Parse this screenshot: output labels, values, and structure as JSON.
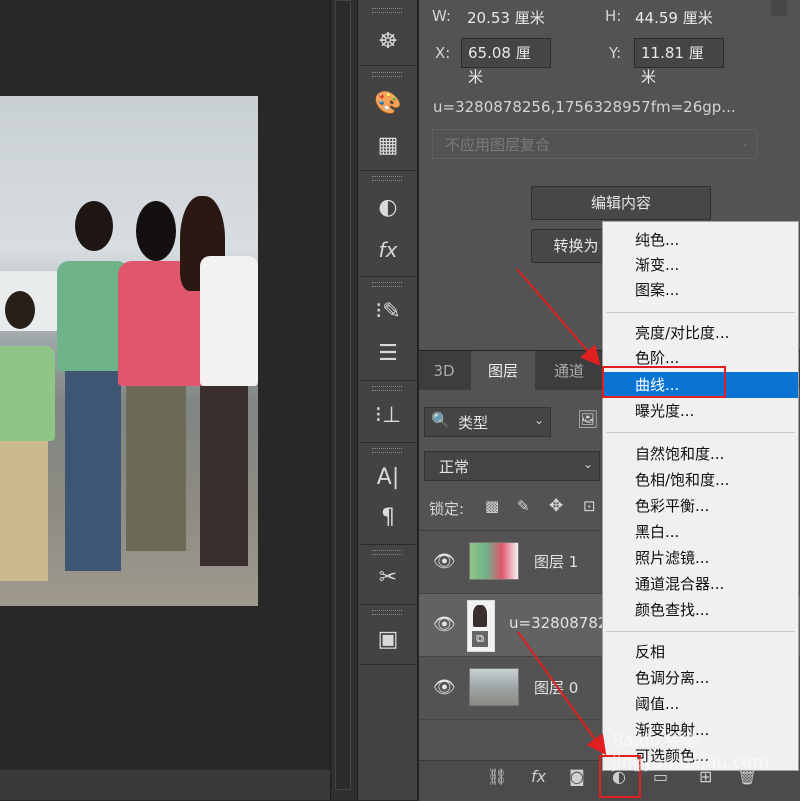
{
  "properties": {
    "w_label": "W:",
    "w_value": "20.53 厘米",
    "h_label": "H:",
    "h_value": "44.59 厘米",
    "x_label": "X:",
    "x_value": "65.08 厘米",
    "y_label": "Y:",
    "y_value": "11.81 厘米",
    "filename": "u=3280878256,1756328957fm=26gp...",
    "comp_select": "不应用图层复合",
    "edit_contents": "编辑内容",
    "convert_to": "转换为"
  },
  "tabs": [
    "3D",
    "图层",
    "通道"
  ],
  "layers_panel": {
    "filter_type": "类型",
    "blend_mode": "正常",
    "lock_label": "锁定:"
  },
  "layers": [
    {
      "name": "图层 1"
    },
    {
      "name": "u=32808782"
    },
    {
      "name": "图层 0"
    }
  ],
  "menu": {
    "group1": [
      "纯色...",
      "渐变...",
      "图案..."
    ],
    "group2": [
      "亮度/对比度...",
      "色阶...",
      "曲线...",
      "曝光度..."
    ],
    "group3": [
      "自然饱和度...",
      "色相/饱和度...",
      "色彩平衡...",
      "黑白...",
      "照片滤镜...",
      "通道混合器...",
      "颜色查找..."
    ],
    "group4": [
      "反相",
      "色调分离...",
      "阈值...",
      "渐变映射...",
      "可选颜色..."
    ],
    "selected": "曲线..."
  },
  "watermark": "Baidu 经验\njingyan.baidu.com",
  "colors": {
    "highlight": "#0a74d4",
    "annotation": "#e02020"
  }
}
